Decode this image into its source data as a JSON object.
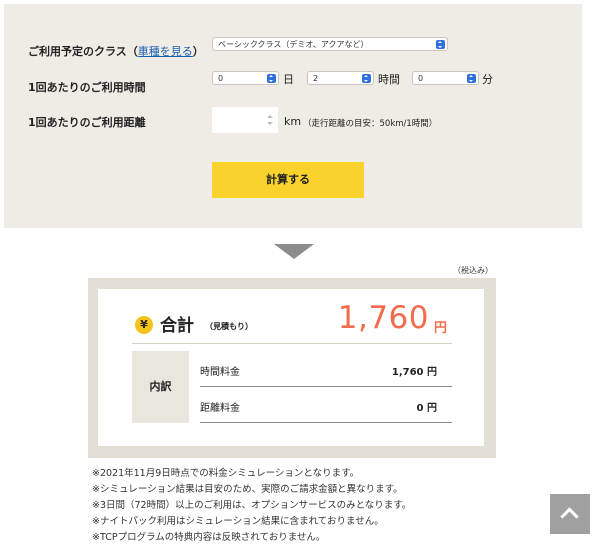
{
  "form": {
    "class_label": "ご利用予定のクラス",
    "class_paren_open": "（",
    "class_link": "車種を見る",
    "class_paren_close": "）",
    "class_select_value": "ベーシッククラス（デミオ、アクアなど）",
    "time_label": "1回あたりのご利用時間",
    "days_value": "0",
    "days_unit": "日",
    "hours_value": "2",
    "hours_unit": "時間",
    "minutes_value": "0",
    "minutes_unit": "分",
    "distance_label": "1回あたりのご利用距離",
    "distance_value": "",
    "distance_unit": "km（走行距離の目安：50km/1時間）",
    "calculate_button": "計算する"
  },
  "result": {
    "tax_note": "（税込み）",
    "yen_symbol": "¥",
    "total_label": "合計",
    "total_sub": "（見積もり）",
    "total_amount": "1,760",
    "total_unit": "円",
    "breakdown_label": "内訳",
    "rows": [
      {
        "label": "時間料金",
        "value": "1,760 円"
      },
      {
        "label": "距離料金",
        "value": "0 円"
      }
    ]
  },
  "notes": [
    "※2021年11月9日時点での料金シミュレーションとなります。",
    "※シミュレーション結果は目安のため、実際のご請求金額と異なります。",
    "※3日間（72時間）以上のご利用は、オプションサービスのみとなります。",
    "※ナイトパック利用はシミュレーション結果に含まれておりません。",
    "※TCPプログラムの特典内容は反映されておりません。"
  ],
  "icons": {
    "arrow": "triangle-down-icon",
    "scroll_top": "chevron-up-icon",
    "select": "select-arrows-icon"
  },
  "colors": {
    "accent_orange": "#f26b4c",
    "button_yellow": "#f9d32b",
    "select_blue": "#2f6fde"
  }
}
